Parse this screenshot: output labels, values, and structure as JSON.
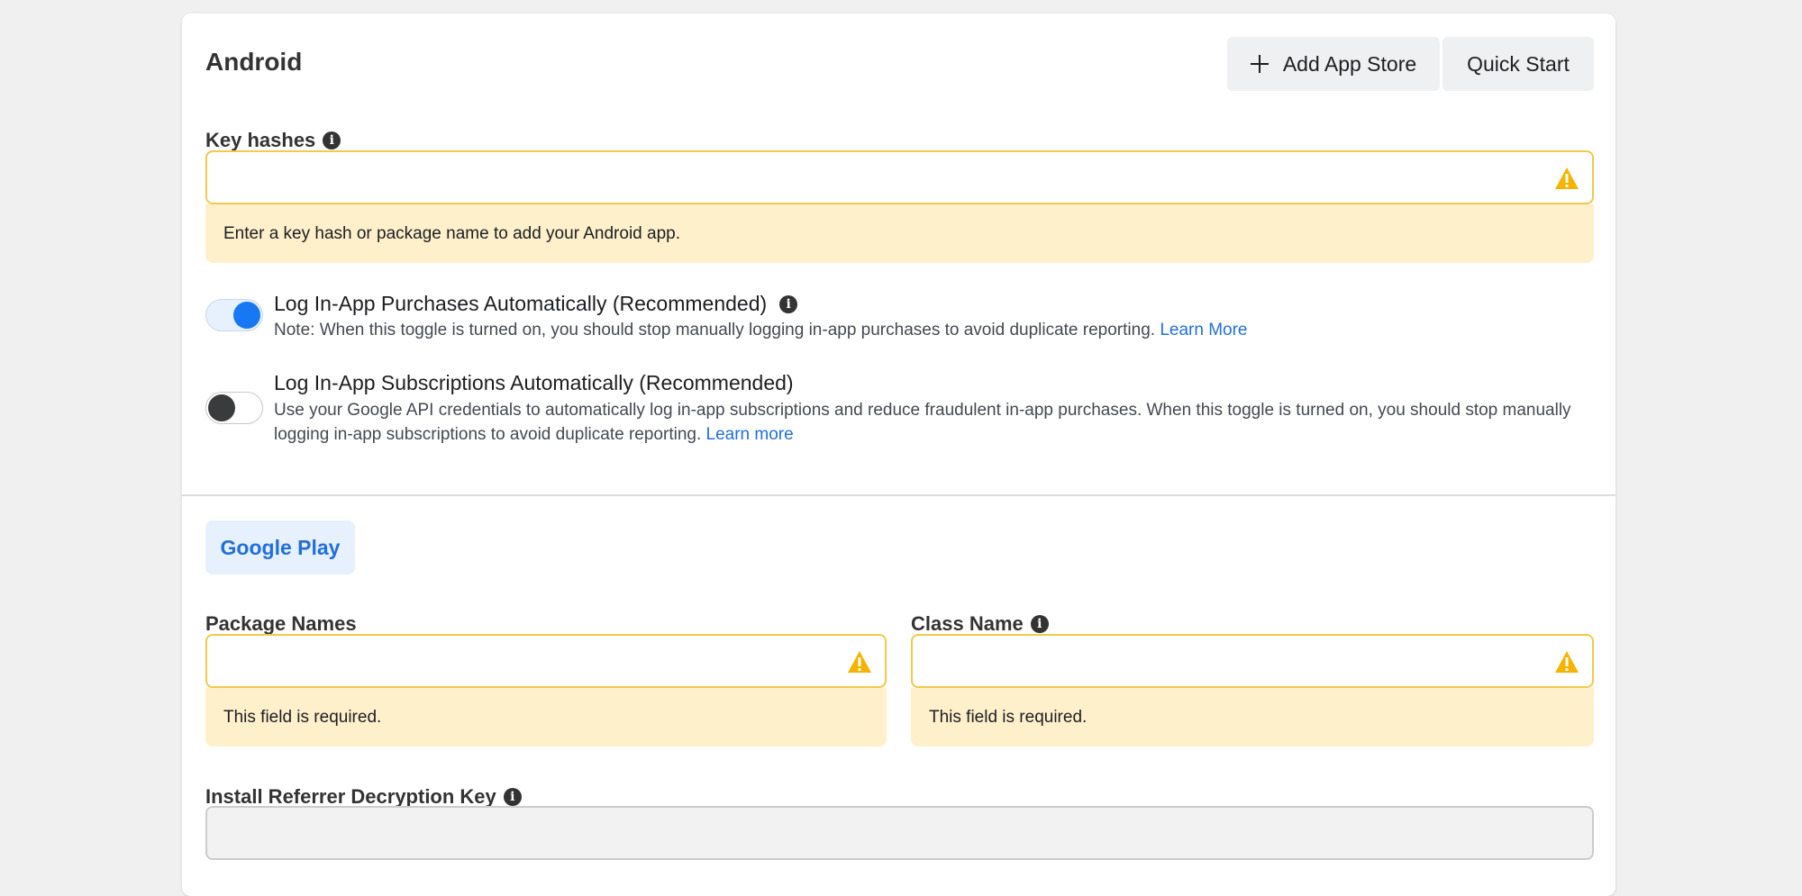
{
  "header": {
    "title": "Android",
    "add_app_store_label": "Add App Store",
    "quick_start_label": "Quick Start"
  },
  "key_hashes": {
    "label": "Key hashes",
    "value": "",
    "warning": "Enter a key hash or package name to add your Android app."
  },
  "purchases_toggle": {
    "enabled": true,
    "title": "Log In-App Purchases Automatically (Recommended)",
    "note": "Note: When this toggle is turned on, you should stop manually logging in-app purchases to avoid duplicate reporting.",
    "link": "Learn More"
  },
  "subscriptions_toggle": {
    "enabled": false,
    "title": "Log In-App Subscriptions Automatically (Recommended)",
    "note": "Use your Google API credentials to automatically log in-app subscriptions and reduce fraudulent in-app purchases. When this toggle is turned on, you should stop manually logging in-app subscriptions to avoid duplicate reporting.",
    "link": "Learn more"
  },
  "store_tab": {
    "label": "Google Play"
  },
  "package_names": {
    "label": "Package Names",
    "value": "",
    "warning": "This field is required."
  },
  "class_name": {
    "label": "Class Name",
    "value": "",
    "warning": "This field is required."
  },
  "install_referrer": {
    "label": "Install Referrer Decryption Key",
    "value": ""
  },
  "colors": {
    "accent": "#1877f2",
    "link": "#216fdb",
    "warning_border": "#f2c94c",
    "warning_bg": "#fff0cc",
    "warning_icon": "#f5b400"
  },
  "icons": {
    "info": "info-icon",
    "warning": "warning-icon",
    "plus": "plus-icon"
  }
}
